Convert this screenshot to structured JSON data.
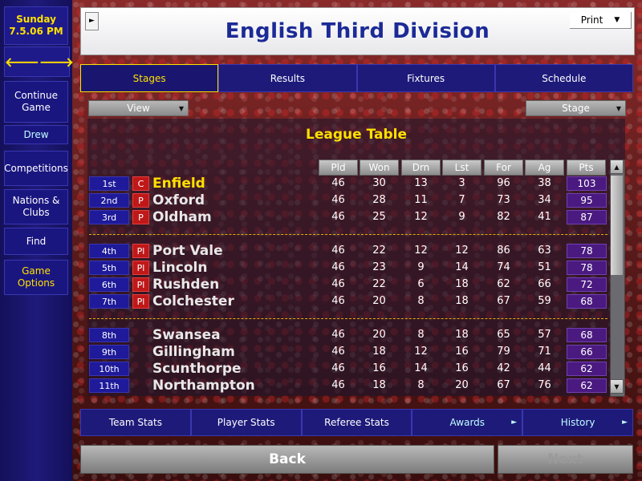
{
  "sidebar": {
    "date_line1": "Sunday",
    "date_line2": "7.5.06 PM",
    "back_arrow": "🡐",
    "forward_arrow": "🡒",
    "items": [
      {
        "label": "Continue Game"
      },
      {
        "label": "Drew"
      },
      {
        "label": "Competitions"
      },
      {
        "label": "Nations & Clubs"
      },
      {
        "label": "Find"
      },
      {
        "label": "Game Options"
      }
    ]
  },
  "header": {
    "title": "English Third Division",
    "menu_arrow": "►",
    "print_label": "Print",
    "dropdown_arrow": "▼"
  },
  "tabs": [
    {
      "label": "Stages"
    },
    {
      "label": "Results"
    },
    {
      "label": "Fixtures"
    },
    {
      "label": "Schedule"
    }
  ],
  "view_dropdown": "View",
  "stage_dropdown": "Stage",
  "table": {
    "title": "League Table",
    "columns": [
      "Pld",
      "Won",
      "Drn",
      "Lst",
      "For",
      "Ag",
      "Pts"
    ],
    "rows": [
      {
        "pos": "1st",
        "mark": "C",
        "team": "Enfield",
        "pld": "46",
        "won": "30",
        "drn": "13",
        "lst": "3",
        "for": "96",
        "ag": "38",
        "pts": "103"
      },
      {
        "pos": "2nd",
        "mark": "P",
        "team": "Oxford",
        "pld": "46",
        "won": "28",
        "drn": "11",
        "lst": "7",
        "for": "73",
        "ag": "34",
        "pts": "95"
      },
      {
        "pos": "3rd",
        "mark": "P",
        "team": "Oldham",
        "pld": "46",
        "won": "25",
        "drn": "12",
        "lst": "9",
        "for": "82",
        "ag": "41",
        "pts": "87"
      },
      {
        "pos": "4th",
        "mark": "Pl",
        "team": "Port Vale",
        "pld": "46",
        "won": "22",
        "drn": "12",
        "lst": "12",
        "for": "86",
        "ag": "63",
        "pts": "78"
      },
      {
        "pos": "5th",
        "mark": "Pl",
        "team": "Lincoln",
        "pld": "46",
        "won": "23",
        "drn": "9",
        "lst": "14",
        "for": "74",
        "ag": "51",
        "pts": "78"
      },
      {
        "pos": "6th",
        "mark": "Pl",
        "team": "Rushden",
        "pld": "46",
        "won": "22",
        "drn": "6",
        "lst": "18",
        "for": "62",
        "ag": "66",
        "pts": "72"
      },
      {
        "pos": "7th",
        "mark": "Pl",
        "team": "Colchester",
        "pld": "46",
        "won": "20",
        "drn": "8",
        "lst": "18",
        "for": "67",
        "ag": "59",
        "pts": "68"
      },
      {
        "pos": "8th",
        "mark": "",
        "team": "Swansea",
        "pld": "46",
        "won": "20",
        "drn": "8",
        "lst": "18",
        "for": "65",
        "ag": "57",
        "pts": "68"
      },
      {
        "pos": "9th",
        "mark": "",
        "team": "Gillingham",
        "pld": "46",
        "won": "18",
        "drn": "12",
        "lst": "16",
        "for": "79",
        "ag": "71",
        "pts": "66"
      },
      {
        "pos": "10th",
        "mark": "",
        "team": "Scunthorpe",
        "pld": "46",
        "won": "16",
        "drn": "14",
        "lst": "16",
        "for": "42",
        "ag": "44",
        "pts": "62"
      },
      {
        "pos": "11th",
        "mark": "",
        "team": "Northampton",
        "pld": "46",
        "won": "18",
        "drn": "8",
        "lst": "20",
        "for": "67",
        "ag": "76",
        "pts": "62"
      }
    ]
  },
  "scroll": {
    "up": "▲",
    "down": "▼"
  },
  "bottom_tabs": [
    {
      "label": "Team Stats"
    },
    {
      "label": "Player Stats"
    },
    {
      "label": "Referee Stats"
    },
    {
      "label": "Awards",
      "arrow": "►"
    },
    {
      "label": "History",
      "arrow": "►"
    }
  ],
  "nav": {
    "back": "Back",
    "next": "Next"
  },
  "colors": {
    "accent_yellow": "#ffe000",
    "panel_blue": "#1e1a7a",
    "title_blue": "#1c2a96",
    "mark_red": "#c01818",
    "pts_purple": "#4a1a80"
  }
}
